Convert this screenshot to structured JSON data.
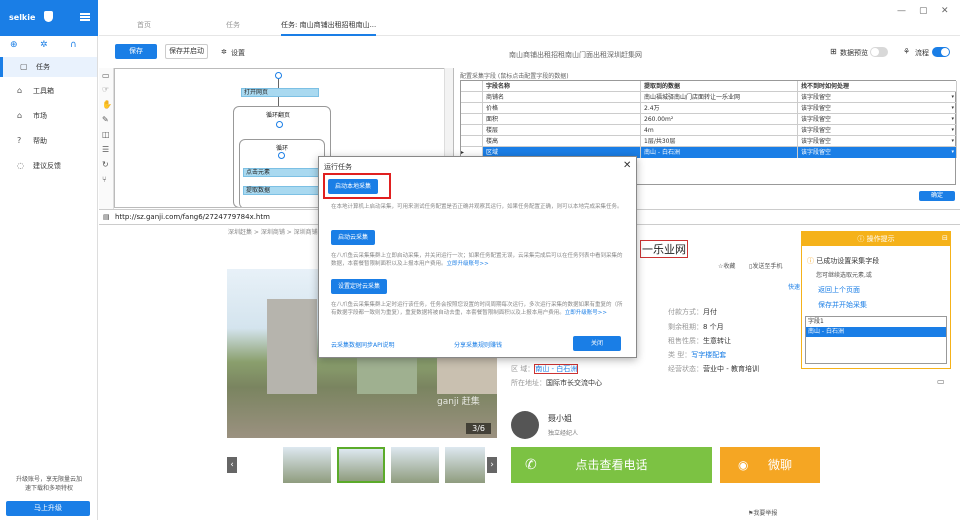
{
  "sidebar": {
    "brand": "selkie",
    "items": [
      {
        "label": "任务",
        "icon": "document-icon"
      },
      {
        "label": "工具箱",
        "icon": "toolbox-icon"
      },
      {
        "label": "市场",
        "icon": "market-icon"
      },
      {
        "label": "帮助",
        "icon": "help-icon"
      },
      {
        "label": "建议反馈",
        "icon": "feedback-icon"
      }
    ],
    "upgrade_note": "升级账号，享无限量云加速下载和多项特权",
    "upgrade_button": "马上升级"
  },
  "tabs": [
    {
      "label": "首页"
    },
    {
      "label": "任务"
    },
    {
      "label": "任务: 南山商铺出租招租南山..."
    }
  ],
  "toolbar": {
    "save": "保存",
    "save_start": "保存并启动",
    "settings": "设置",
    "title": "南山商铺出租招租南山门面出租深圳赶集网",
    "data_preview": "数据预览",
    "flow": "流程"
  },
  "workflow": {
    "open_page": "打开网页",
    "loop_page": "循环翻页",
    "loop": "循环",
    "click_element": "点击元素",
    "extract_data": "提取数据"
  },
  "config": {
    "title": "配置采集字段 (鼠标点击配置字段的数据)",
    "headers": [
      "字段名称",
      "提取到的数据",
      "找不到时如何处理"
    ],
    "rows": [
      [
        "商铺名",
        "南山福城驿南山门店面转让一乐业网",
        "该字段留空"
      ],
      [
        "价格",
        "2.4万",
        "该字段留空"
      ],
      [
        "面积",
        "260.00m²",
        "该字段留空"
      ],
      [
        "楼层",
        "4m",
        "该字段留空"
      ],
      [
        "楼高",
        "1层/共30层",
        "该字段留空"
      ],
      [
        "区域",
        "南山 - 白石洲",
        "该字段留空"
      ]
    ],
    "confirm": "确定"
  },
  "url": "http://sz.ganji.com/fang6/2724779784x.htm",
  "page": {
    "breadcrumb": "深圳赶集 > 深圳商铺 > 深圳商铺...",
    "headline_tail": "一乐业网",
    "favorite": "收藏",
    "send_phone": "发送至手机",
    "quick": "快速",
    "pic_count": "3/6",
    "info": [
      {
        "k": "付款方式：",
        "v": "月付"
      },
      {
        "k": "剩余租期：",
        "v": "8 个月"
      },
      {
        "k": "租售性质：",
        "v": "生意转让"
      },
      {
        "k": "类    型：",
        "v": "写字楼配套"
      },
      {
        "k": "经营状态：",
        "v": "营业中 - 教育培训"
      }
    ],
    "district_label": "区    域：",
    "district_value": "南山 - 白石洲",
    "address_label": "所在地址：",
    "address_value": "国际市长交流中心",
    "agent_name": "聂小姐",
    "agent_role": "独立经纪人",
    "call": "点击查看电话",
    "chat": "微聊",
    "report": "我要举报",
    "watermark": "ganji 赶集"
  },
  "modal": {
    "title": "运行任务",
    "local_button": "启动本地采集",
    "local_desc": "在本地计算机上启动采集，可用来测试任务配置是否正确并观察其运行，如果任务配置正确，则可以本地完成采集任务。",
    "cloud_button": "启动云采集",
    "cloud_desc": "在八爪鱼云采集集群上立即启动采集，并关闭运行一次；如果任务配置无误，云采集完成后可以在任务列表中看到采集的数据，本套餐暂限制面积以及上报本用户费用。",
    "cloud_link": "立即升级账号>>",
    "timer_button": "设置定时云采集",
    "timer_desc": "在八爪鱼云采集集群上定时运行该任务，任务会按照您设置的时间周期每次运行，多次运行采集的数据如果有重复的（所有数据字段都一致则为重复），重复数据将被自动去重，本套餐暂限制面积以及上报本用户费用。",
    "timer_link": "立即升级账号>>",
    "api_link": "云采集数据同步API说明",
    "rule_link": "分享采集规则赚钱",
    "close": "关闭"
  },
  "hint": {
    "title": "操作提示",
    "success": "已成功设置采集字段",
    "next": "您可继续选取元素,或",
    "back_link": "返回上个页面",
    "save_link": "保存并开始采集",
    "list_header": "字段1",
    "list_value": "南山 - 白石洲"
  }
}
